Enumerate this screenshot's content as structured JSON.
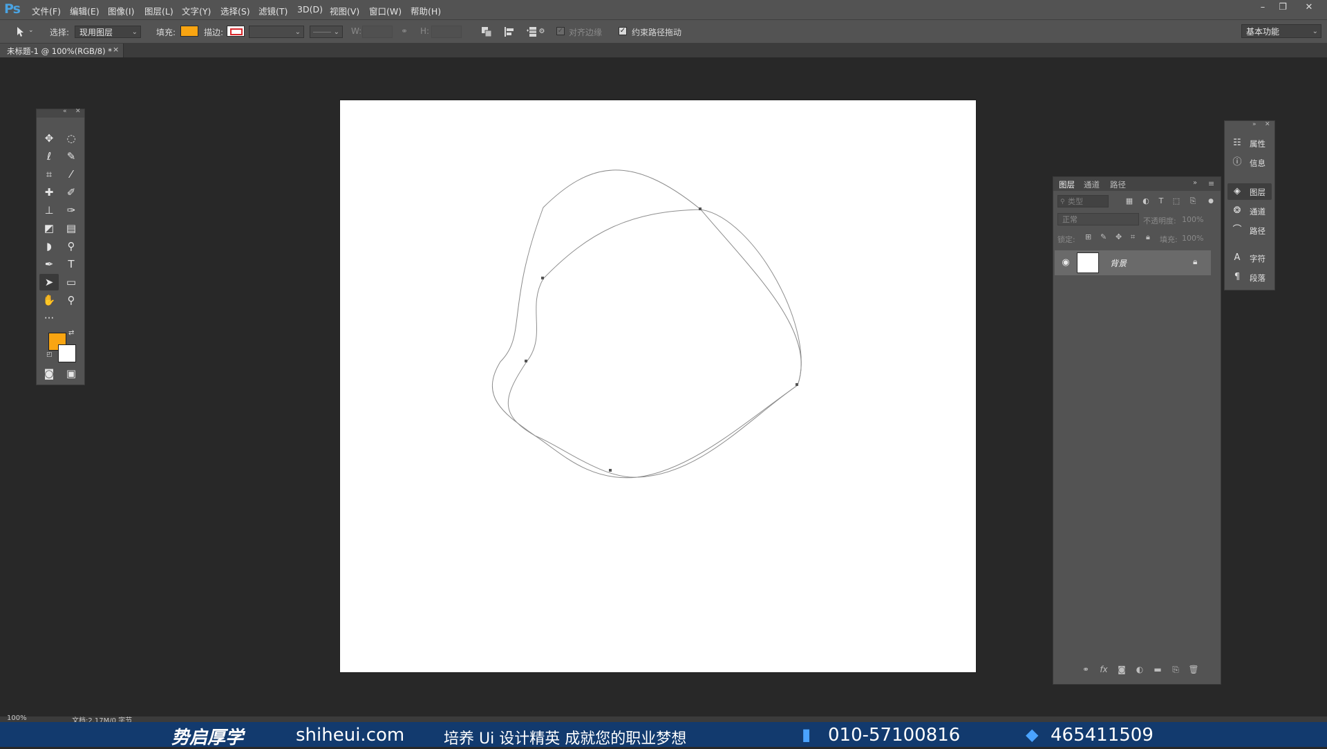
{
  "app": {
    "logo": "Ps"
  },
  "menu": [
    "文件(F)",
    "编辑(E)",
    "图像(I)",
    "图层(L)",
    "文字(Y)",
    "选择(S)",
    "滤镜(T)",
    "3D(D)",
    "视图(V)",
    "窗口(W)",
    "帮助(H)"
  ],
  "window_controls": {
    "minimize": "–",
    "restore": "❐",
    "close": "✕"
  },
  "options": {
    "select_label": "选择:",
    "select_value": "现用图层",
    "fill_label": "填充:",
    "fill_color": "#f9a512",
    "stroke_label": "描边:",
    "stroke_color": "#d8262a",
    "w_label": "W:",
    "h_label": "H:",
    "align_edges_label": "对齐边缘",
    "constrain_label": "约束路径拖动",
    "workspace": "基本功能"
  },
  "document_tab": {
    "label": "未标题-1 @ 100%(RGB/8) *",
    "close": "×"
  },
  "toolbox": {
    "tools": [
      "move-tool",
      "marquee-tool",
      "lasso-tool",
      "quick-selection-tool",
      "crop-tool",
      "eyedropper-tool",
      "healing-brush-tool",
      "brush-tool",
      "clone-stamp-tool",
      "history-brush-tool",
      "eraser-tool",
      "gradient-tool",
      "blur-tool",
      "dodge-tool",
      "pen-tool",
      "type-tool",
      "path-selection-tool",
      "rectangle-tool",
      "hand-tool",
      "zoom-tool",
      "more-tools"
    ],
    "foreground_color": "#f9a512",
    "background_color": "#ffffff"
  },
  "dock": [
    {
      "label": "属性",
      "icon": "properties-icon"
    },
    {
      "label": "信息",
      "icon": "info-icon"
    },
    {
      "label": "图层",
      "icon": "layers-icon"
    },
    {
      "label": "通道",
      "icon": "channels-icon"
    },
    {
      "label": "路径",
      "icon": "paths-icon"
    },
    {
      "label": "字符",
      "icon": "character-icon"
    },
    {
      "label": "段落",
      "icon": "paragraph-icon"
    }
  ],
  "layers_panel": {
    "tabs": [
      "图层",
      "通道",
      "路径"
    ],
    "filter_placeholder": "类型",
    "blend_mode": "正常",
    "opacity_label": "不透明度:",
    "opacity_value": "100%",
    "lock_label": "锁定:",
    "fill_label": "填充:",
    "fill_value": "100%",
    "layers": [
      {
        "name": "背景",
        "visible": true,
        "locked": true
      }
    ]
  },
  "status": {
    "zoom": "100%",
    "doc_info": "文档:2.17M/0 字节"
  },
  "banner": {
    "brand": "势启厚学",
    "site": "shiheui.com",
    "slogan": "培养 Ui 设计精英 成就您的职业梦想",
    "phone": "010-57100816",
    "qq": "465411509"
  }
}
